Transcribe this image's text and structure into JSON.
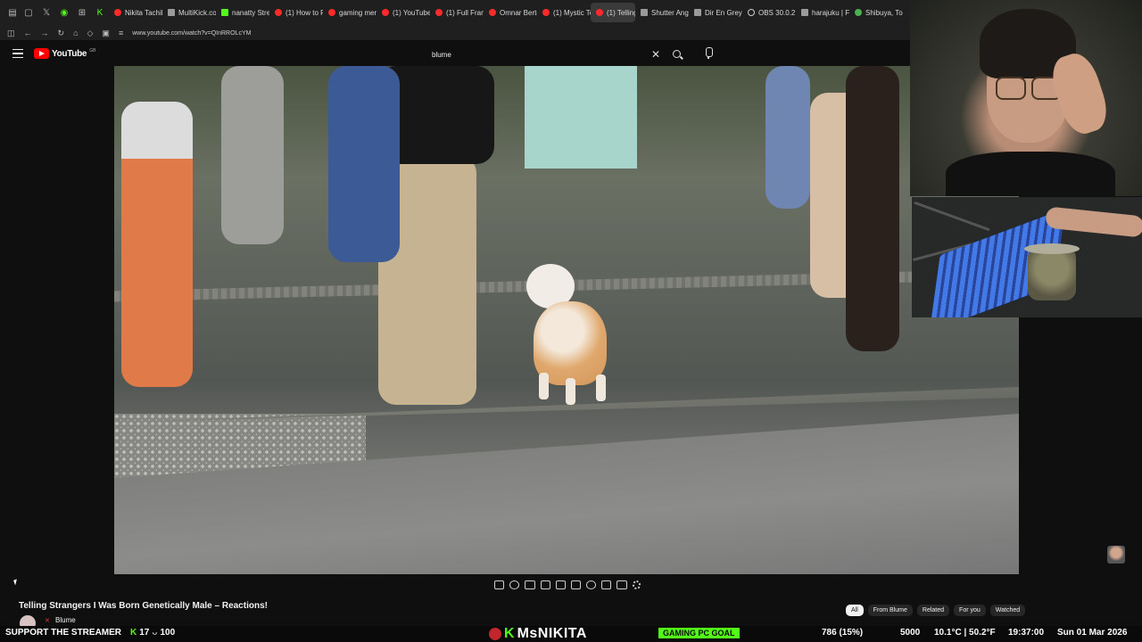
{
  "browser": {
    "tabs": [
      {
        "label": "Nikita Tachib",
        "icon": "youtube"
      },
      {
        "label": "MultiKick.com",
        "icon": "grey"
      },
      {
        "label": "nanatty Strea",
        "icon": "kick"
      },
      {
        "label": "(1) How to Pu",
        "icon": "youtube"
      },
      {
        "label": "gaming merc",
        "icon": "youtube"
      },
      {
        "label": "(1) YouTube",
        "icon": "youtube"
      },
      {
        "label": "(1) Full Frame",
        "icon": "youtube"
      },
      {
        "label": "Omnar Bertel",
        "icon": "youtube"
      },
      {
        "label": "(1) Mystic Tec",
        "icon": "youtube"
      },
      {
        "label": "(1) Telling",
        "icon": "youtube",
        "active": true
      },
      {
        "label": "Shutter Angle",
        "icon": "grey"
      },
      {
        "label": "Dir En Grey",
        "icon": "grey"
      },
      {
        "label": "OBS 30.0.2 m",
        "icon": "obs"
      },
      {
        "label": "harajuku | Fe",
        "icon": "grey"
      },
      {
        "label": "Shibuya, To",
        "icon": "pin"
      }
    ],
    "url": "www.youtube.com/watch?v=QInRROLcYM"
  },
  "youtube": {
    "logo_text": "YouTube",
    "country_code": "GB",
    "search_value": "blume",
    "video_title": "Telling Strangers I Was Born Genetically Male – Reactions!",
    "channel_name": "Blume",
    "chips": [
      "All",
      "From Blume",
      "Related",
      "For you",
      "Watched"
    ],
    "active_chip": "All"
  },
  "overlay": {
    "support": "SUPPORT THE STREAMER",
    "kick_count": "17",
    "separator_count": "100",
    "brand": "MsNIKITA",
    "goal_label": "GAMING PC GOAL",
    "goal_progress": "786 (15%)",
    "goal_target": "5000",
    "weather": "10.1°C | 50.2°F",
    "time": "19:37:00",
    "date": "Sun 01 Mar 2026"
  },
  "colors": {
    "youtube_red": "#ff0000",
    "kick_green": "#53fc18",
    "background": "#0f0f0f"
  }
}
